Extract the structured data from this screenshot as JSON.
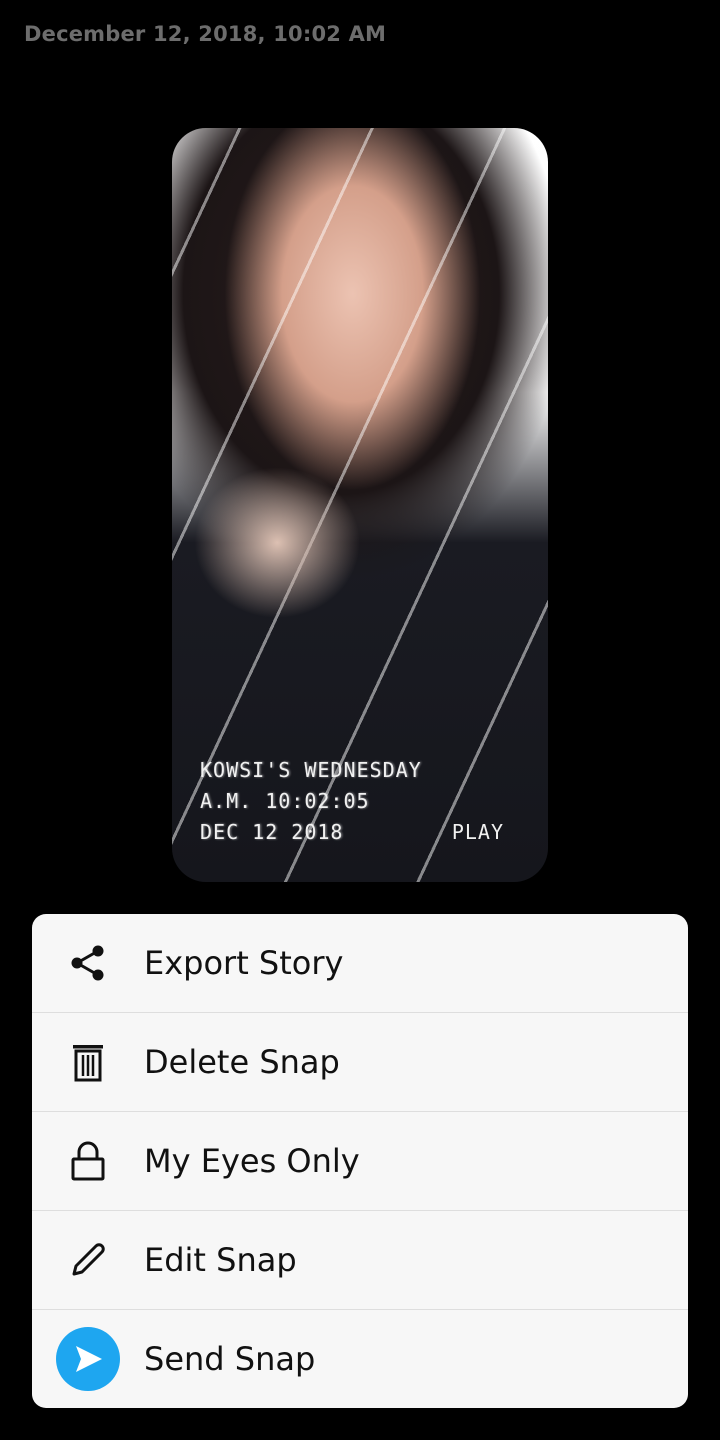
{
  "header": {
    "timestamp": "December 12, 2018, 10:02 AM"
  },
  "snap": {
    "overlay_line1": "KOWSI'S WEDNESDAY",
    "overlay_line2": "A.M. 10:02:05",
    "overlay_line3": "DEC 12 2018",
    "overlay_play": "PLAY"
  },
  "menu": {
    "items": [
      {
        "label": "Export Story",
        "icon": "share-icon"
      },
      {
        "label": "Delete Snap",
        "icon": "trash-icon"
      },
      {
        "label": "My Eyes Only",
        "icon": "lock-icon"
      },
      {
        "label": "Edit Snap",
        "icon": "pencil-icon"
      },
      {
        "label": "Send Snap",
        "icon": "send-icon"
      }
    ]
  },
  "colors": {
    "background": "#000000",
    "menu_background": "#f7f7f7",
    "send_accent": "#1ea6f0",
    "timestamp_text": "#6d6d6d"
  }
}
